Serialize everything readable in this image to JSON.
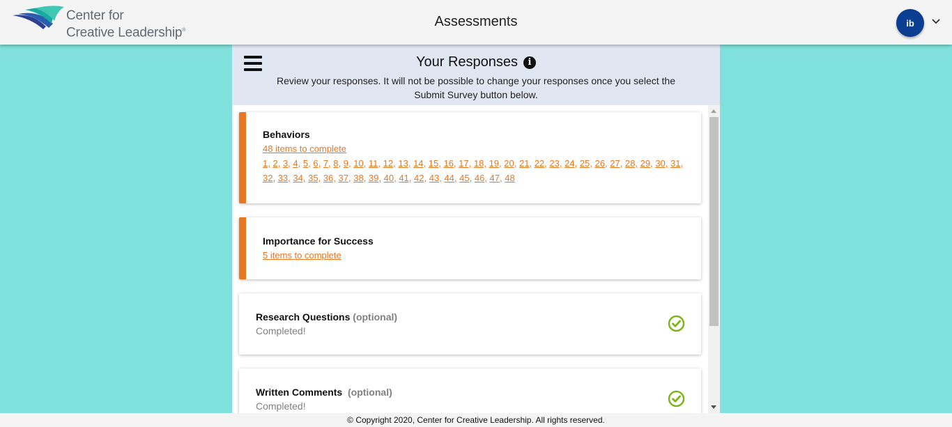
{
  "header": {
    "logo_line1": "Center for",
    "logo_line2": "Creative Leadership",
    "logo_mark": "®",
    "title": "Assessments",
    "avatar_initials": "ib"
  },
  "panel": {
    "title": "Your Responses",
    "info_icon": "i",
    "subtitle": "Review your responses. It will not be possible to change your responses once you select the Submit Survey button below."
  },
  "sections": [
    {
      "title": "Behaviors",
      "link": "48 items to complete",
      "items": [
        "1",
        "2",
        "3",
        "4",
        "5",
        "6",
        "7",
        "8",
        "9",
        "10",
        "11",
        "12",
        "13",
        "14",
        "15",
        "16",
        "17",
        "18",
        "19",
        "20",
        "21",
        "22",
        "23",
        "24",
        "25",
        "26",
        "27",
        "28",
        "29",
        "30",
        "31",
        "32",
        "33",
        "34",
        "35",
        "36",
        "37",
        "38",
        "39",
        "40",
        "41",
        "42",
        "43",
        "44",
        "45",
        "46",
        "47",
        "48"
      ],
      "status": "incomplete"
    },
    {
      "title": "Importance for Success",
      "link": "5 items to complete",
      "status": "incomplete"
    },
    {
      "title": "Research Questions",
      "optional": "(optional)",
      "status_text": "Completed!",
      "status": "complete"
    },
    {
      "title": "Written Comments",
      "optional": "(optional)",
      "status_text": "Completed!",
      "status": "complete"
    }
  ],
  "footer": {
    "copyright": "© Copyright 2020, Center for Creative Leadership. All rights reserved."
  },
  "colors": {
    "accent_orange": "#e87722",
    "check_green": "#7cb518",
    "avatar_blue": "#0b3d91",
    "background_teal": "#80e0dc"
  },
  "icons": [
    "logo-wing-icon",
    "chevron-down-icon",
    "hamburger-menu-icon",
    "info-icon",
    "check-circle-icon"
  ]
}
